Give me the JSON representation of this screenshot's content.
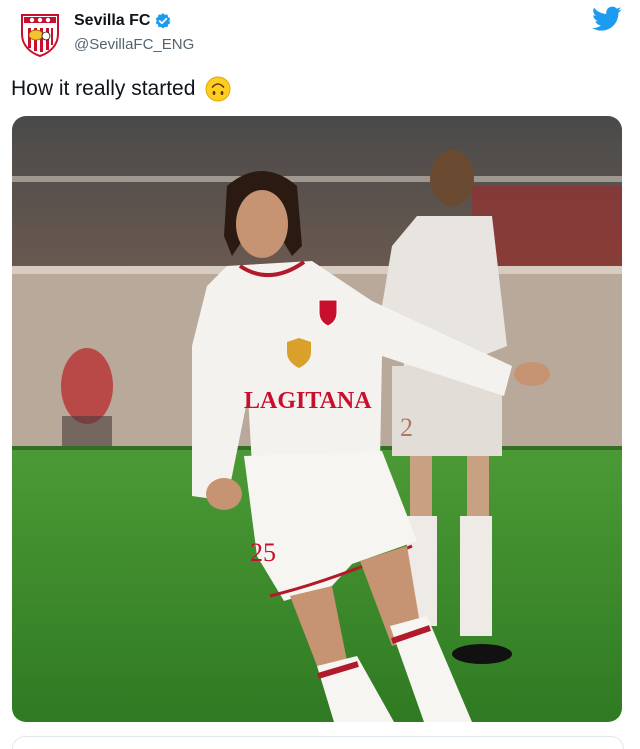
{
  "tweet": {
    "display_name": "Sevilla FC",
    "handle": "@SevillaFC_ENG",
    "text": "How it really started",
    "avatar_icon": "sevilla-crest-icon",
    "verified_icon": "verified-badge-icon",
    "brand_icon": "twitter-bird-icon",
    "emoji_icon": "upside-down-face-emoji-icon"
  },
  "photo": {
    "shirt_sponsor": "LAGITANA",
    "shirt_number": "25",
    "bg_player_number": "2"
  },
  "colors": {
    "brand_blue": "#1d9bf0",
    "sevilla_red": "#c8102e",
    "pitch_green": "#3f8a2a"
  }
}
